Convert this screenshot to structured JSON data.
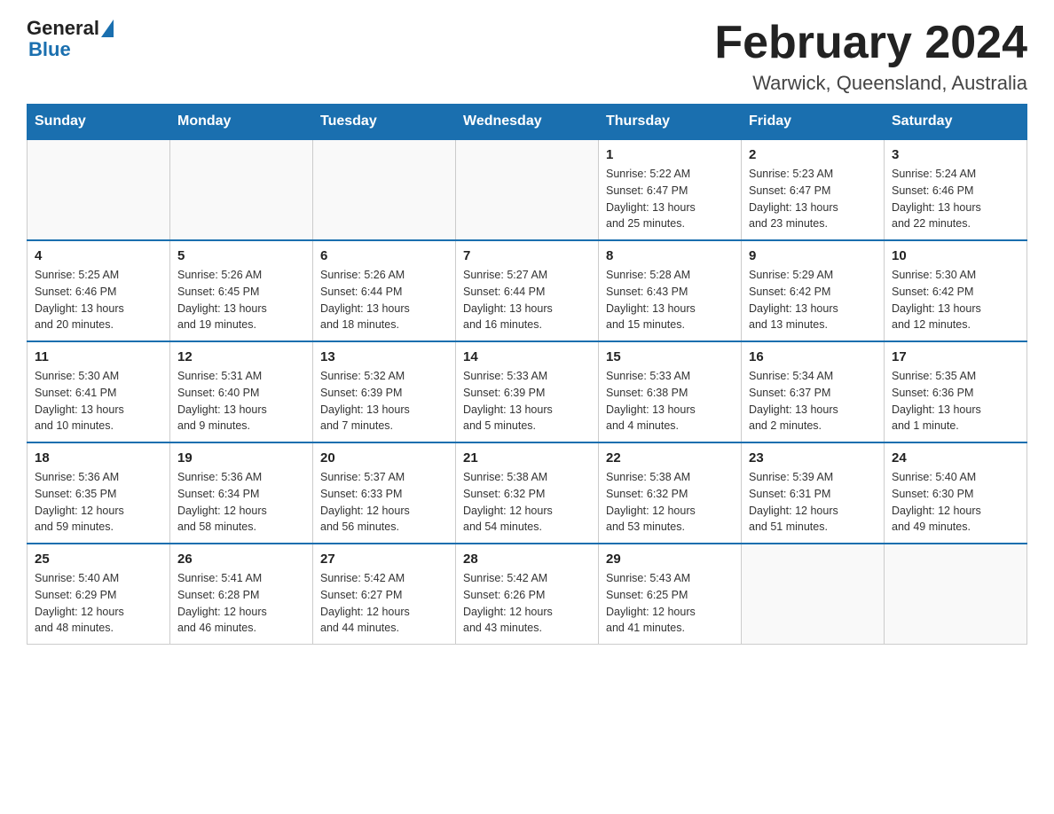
{
  "header": {
    "logo_general": "General",
    "logo_blue": "Blue",
    "title": "February 2024",
    "subtitle": "Warwick, Queensland, Australia"
  },
  "days_of_week": [
    "Sunday",
    "Monday",
    "Tuesday",
    "Wednesday",
    "Thursday",
    "Friday",
    "Saturday"
  ],
  "weeks": [
    {
      "cells": [
        {
          "day": "",
          "info": "",
          "empty": true
        },
        {
          "day": "",
          "info": "",
          "empty": true
        },
        {
          "day": "",
          "info": "",
          "empty": true
        },
        {
          "day": "",
          "info": "",
          "empty": true
        },
        {
          "day": "1",
          "info": "Sunrise: 5:22 AM\nSunset: 6:47 PM\nDaylight: 13 hours\nand 25 minutes.",
          "empty": false
        },
        {
          "day": "2",
          "info": "Sunrise: 5:23 AM\nSunset: 6:47 PM\nDaylight: 13 hours\nand 23 minutes.",
          "empty": false
        },
        {
          "day": "3",
          "info": "Sunrise: 5:24 AM\nSunset: 6:46 PM\nDaylight: 13 hours\nand 22 minutes.",
          "empty": false
        }
      ]
    },
    {
      "cells": [
        {
          "day": "4",
          "info": "Sunrise: 5:25 AM\nSunset: 6:46 PM\nDaylight: 13 hours\nand 20 minutes.",
          "empty": false
        },
        {
          "day": "5",
          "info": "Sunrise: 5:26 AM\nSunset: 6:45 PM\nDaylight: 13 hours\nand 19 minutes.",
          "empty": false
        },
        {
          "day": "6",
          "info": "Sunrise: 5:26 AM\nSunset: 6:44 PM\nDaylight: 13 hours\nand 18 minutes.",
          "empty": false
        },
        {
          "day": "7",
          "info": "Sunrise: 5:27 AM\nSunset: 6:44 PM\nDaylight: 13 hours\nand 16 minutes.",
          "empty": false
        },
        {
          "day": "8",
          "info": "Sunrise: 5:28 AM\nSunset: 6:43 PM\nDaylight: 13 hours\nand 15 minutes.",
          "empty": false
        },
        {
          "day": "9",
          "info": "Sunrise: 5:29 AM\nSunset: 6:42 PM\nDaylight: 13 hours\nand 13 minutes.",
          "empty": false
        },
        {
          "day": "10",
          "info": "Sunrise: 5:30 AM\nSunset: 6:42 PM\nDaylight: 13 hours\nand 12 minutes.",
          "empty": false
        }
      ]
    },
    {
      "cells": [
        {
          "day": "11",
          "info": "Sunrise: 5:30 AM\nSunset: 6:41 PM\nDaylight: 13 hours\nand 10 minutes.",
          "empty": false
        },
        {
          "day": "12",
          "info": "Sunrise: 5:31 AM\nSunset: 6:40 PM\nDaylight: 13 hours\nand 9 minutes.",
          "empty": false
        },
        {
          "day": "13",
          "info": "Sunrise: 5:32 AM\nSunset: 6:39 PM\nDaylight: 13 hours\nand 7 minutes.",
          "empty": false
        },
        {
          "day": "14",
          "info": "Sunrise: 5:33 AM\nSunset: 6:39 PM\nDaylight: 13 hours\nand 5 minutes.",
          "empty": false
        },
        {
          "day": "15",
          "info": "Sunrise: 5:33 AM\nSunset: 6:38 PM\nDaylight: 13 hours\nand 4 minutes.",
          "empty": false
        },
        {
          "day": "16",
          "info": "Sunrise: 5:34 AM\nSunset: 6:37 PM\nDaylight: 13 hours\nand 2 minutes.",
          "empty": false
        },
        {
          "day": "17",
          "info": "Sunrise: 5:35 AM\nSunset: 6:36 PM\nDaylight: 13 hours\nand 1 minute.",
          "empty": false
        }
      ]
    },
    {
      "cells": [
        {
          "day": "18",
          "info": "Sunrise: 5:36 AM\nSunset: 6:35 PM\nDaylight: 12 hours\nand 59 minutes.",
          "empty": false
        },
        {
          "day": "19",
          "info": "Sunrise: 5:36 AM\nSunset: 6:34 PM\nDaylight: 12 hours\nand 58 minutes.",
          "empty": false
        },
        {
          "day": "20",
          "info": "Sunrise: 5:37 AM\nSunset: 6:33 PM\nDaylight: 12 hours\nand 56 minutes.",
          "empty": false
        },
        {
          "day": "21",
          "info": "Sunrise: 5:38 AM\nSunset: 6:32 PM\nDaylight: 12 hours\nand 54 minutes.",
          "empty": false
        },
        {
          "day": "22",
          "info": "Sunrise: 5:38 AM\nSunset: 6:32 PM\nDaylight: 12 hours\nand 53 minutes.",
          "empty": false
        },
        {
          "day": "23",
          "info": "Sunrise: 5:39 AM\nSunset: 6:31 PM\nDaylight: 12 hours\nand 51 minutes.",
          "empty": false
        },
        {
          "day": "24",
          "info": "Sunrise: 5:40 AM\nSunset: 6:30 PM\nDaylight: 12 hours\nand 49 minutes.",
          "empty": false
        }
      ]
    },
    {
      "cells": [
        {
          "day": "25",
          "info": "Sunrise: 5:40 AM\nSunset: 6:29 PM\nDaylight: 12 hours\nand 48 minutes.",
          "empty": false
        },
        {
          "day": "26",
          "info": "Sunrise: 5:41 AM\nSunset: 6:28 PM\nDaylight: 12 hours\nand 46 minutes.",
          "empty": false
        },
        {
          "day": "27",
          "info": "Sunrise: 5:42 AM\nSunset: 6:27 PM\nDaylight: 12 hours\nand 44 minutes.",
          "empty": false
        },
        {
          "day": "28",
          "info": "Sunrise: 5:42 AM\nSunset: 6:26 PM\nDaylight: 12 hours\nand 43 minutes.",
          "empty": false
        },
        {
          "day": "29",
          "info": "Sunrise: 5:43 AM\nSunset: 6:25 PM\nDaylight: 12 hours\nand 41 minutes.",
          "empty": false
        },
        {
          "day": "",
          "info": "",
          "empty": true
        },
        {
          "day": "",
          "info": "",
          "empty": true
        }
      ]
    }
  ]
}
